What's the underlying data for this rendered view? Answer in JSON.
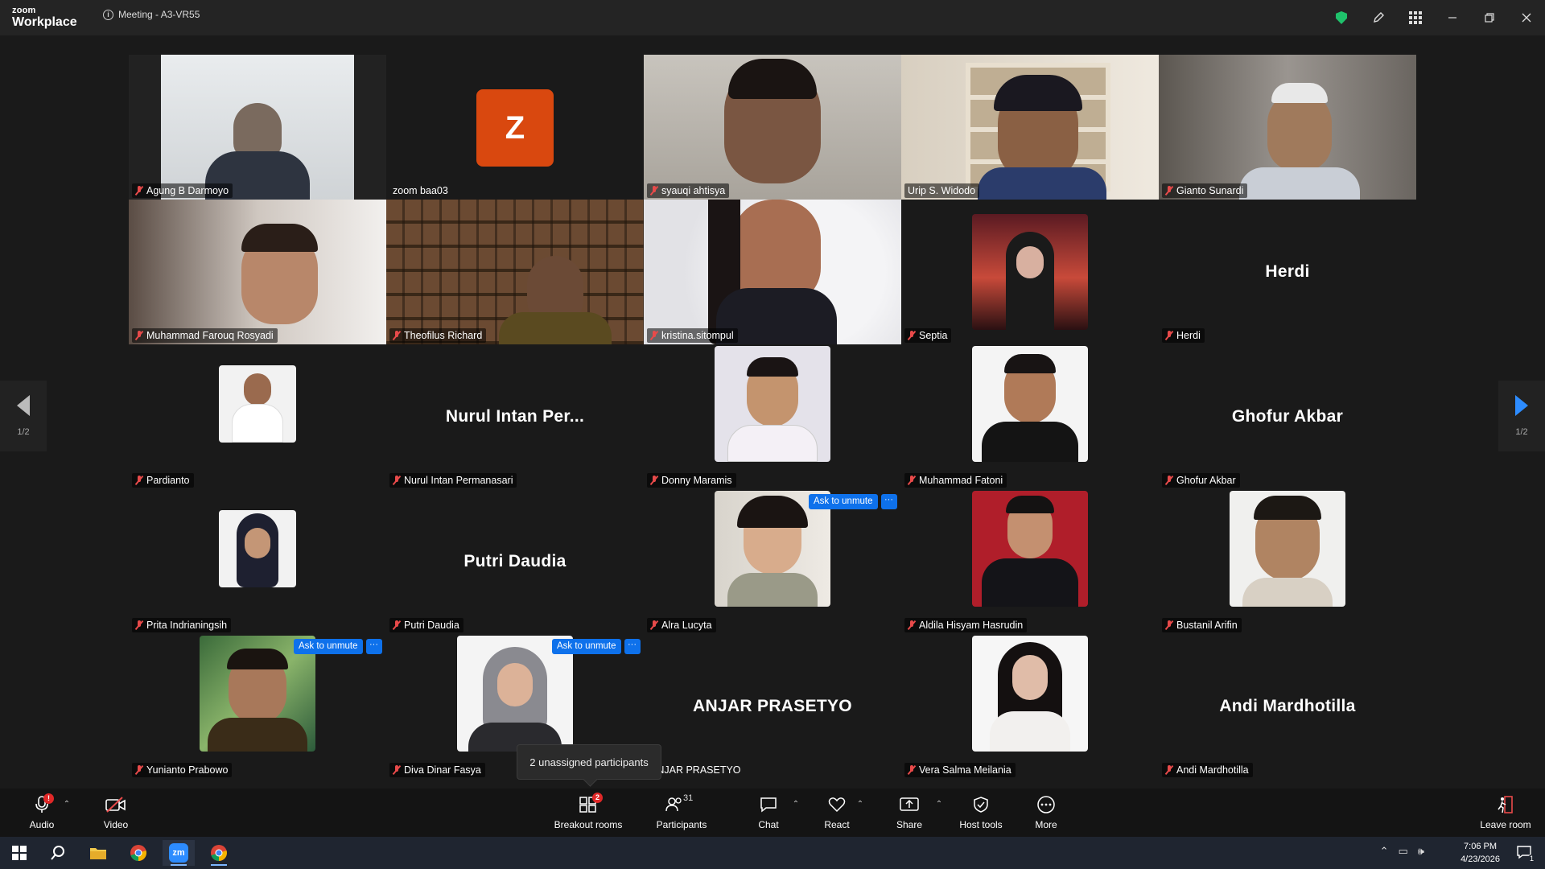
{
  "app": {
    "brand_top": "zoom",
    "brand_bottom": "Workplace",
    "meeting_title": "Meeting - A3-VR55"
  },
  "colors": {
    "accent": "#0e71eb",
    "speaker_border": "#23d18b",
    "muted": "#e84a4a",
    "avatar_z": "#d9480f"
  },
  "tiles": [
    {
      "name": "Agung B Darmoyo",
      "kind": "video"
    },
    {
      "name": "zoom baa03",
      "kind": "avatar",
      "initial": "Z"
    },
    {
      "name": "syauqi ahtisya",
      "kind": "video"
    },
    {
      "name": "Urip S. Widodo",
      "kind": "video",
      "active_speaker": true
    },
    {
      "name": "Gianto Sunardi",
      "kind": "video"
    },
    {
      "name": "Muhammad Farouq Rosyadi",
      "kind": "video"
    },
    {
      "name": "Theofilus Richard",
      "kind": "video"
    },
    {
      "name": "kristina.sitompul",
      "kind": "video"
    },
    {
      "name": "Septia",
      "kind": "photo"
    },
    {
      "name": "Herdi",
      "kind": "name",
      "display": "Herdi"
    },
    {
      "name": "Pardianto",
      "kind": "photo"
    },
    {
      "name": "Nurul Intan Permanasari",
      "kind": "name",
      "display": "Nurul Intan Per..."
    },
    {
      "name": "Donny Maramis",
      "kind": "photo"
    },
    {
      "name": "Muhammad Fatoni",
      "kind": "photo"
    },
    {
      "name": "Ghofur Akbar",
      "kind": "name",
      "display": "Ghofur Akbar"
    },
    {
      "name": "Prita Indrianingsih",
      "kind": "photo"
    },
    {
      "name": "Putri Daudia",
      "kind": "name",
      "display": "Putri Daudia"
    },
    {
      "name": "Alra Lucyta",
      "kind": "photo"
    },
    {
      "name": "Aldila Hisyam Hasrudin",
      "kind": "photo"
    },
    {
      "name": "Bustanil Arifin",
      "kind": "photo"
    },
    {
      "name": "Yunianto Prabowo",
      "kind": "photo"
    },
    {
      "name": "Diva Dinar Fasya",
      "kind": "photo"
    },
    {
      "name": "ANJAR PRASETYO",
      "kind": "name",
      "display": "ANJAR PRASETYO"
    },
    {
      "name": "Vera Salma Meilania",
      "kind": "photo"
    },
    {
      "name": "Andi Mardhotilla",
      "kind": "name",
      "display": "Andi Mardhotilla"
    }
  ],
  "ask_to_unmute": {
    "label": "Ask to unmute",
    "more": "···"
  },
  "pager": {
    "left_page": "1/2",
    "right_page": "1/2"
  },
  "tooltip": "2 unassigned participants",
  "toolbar": {
    "audio": "Audio",
    "video": "Video",
    "breakout": "Breakout rooms",
    "breakout_badge": "2",
    "participants": "Participants",
    "participants_count": "31",
    "chat": "Chat",
    "react": "React",
    "share": "Share",
    "host_tools": "Host tools",
    "more": "More",
    "leave": "Leave room",
    "audio_badge": "!"
  },
  "taskbar": {
    "time": "7:06 PM",
    "date": "4/23/2026",
    "notifications": "1"
  }
}
